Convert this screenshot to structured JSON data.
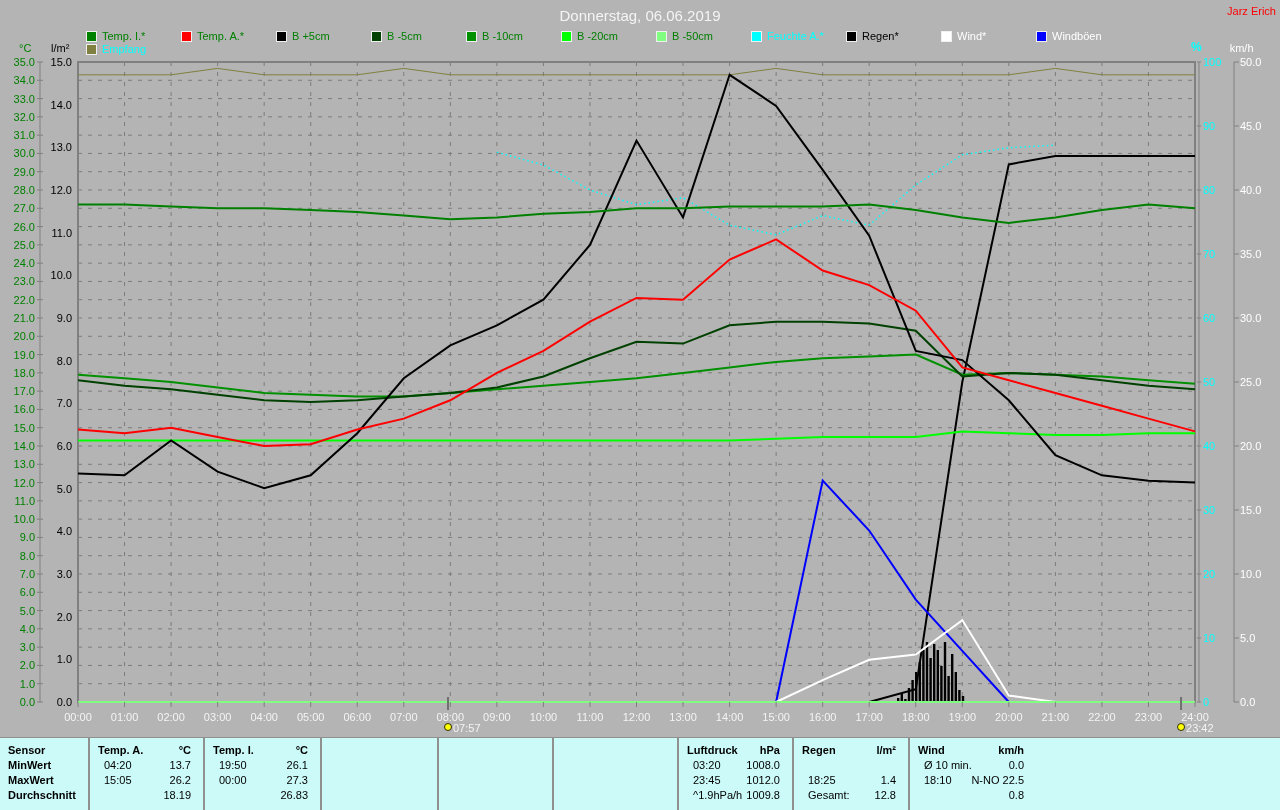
{
  "window": {
    "title": "Donnerstag, 06.06.2019",
    "author": "Jarz Erich"
  },
  "chart": {
    "axes": [
      {
        "kind": "y",
        "unit": "°C",
        "color": "#008000"
      },
      {
        "kind": "rain",
        "unit": "l/m²",
        "color": "#000000"
      },
      {
        "kind": "y2",
        "unit": "%",
        "color": "#00ffff"
      },
      {
        "kind": "y3",
        "unit": "km/h",
        "color": "#ffffff"
      }
    ],
    "chart_data": {
      "type": "line",
      "x": [
        "00:00",
        "01:00",
        "02:00",
        "03:00",
        "04:00",
        "05:00",
        "06:00",
        "07:00",
        "08:00",
        "09:00",
        "10:00",
        "11:00",
        "12:00",
        "13:00",
        "14:00",
        "15:00",
        "16:00",
        "17:00",
        "18:00",
        "19:00",
        "20:00",
        "21:00",
        "22:00",
        "23:00",
        "24:00"
      ],
      "yticks": [
        {
          "value": 35,
          "label": "35.0"
        },
        {
          "value": 34,
          "label": "34.0"
        },
        {
          "value": 33,
          "label": "33.0"
        },
        {
          "value": 32,
          "label": "32.0"
        },
        {
          "value": 31,
          "label": "31.0"
        },
        {
          "value": 30,
          "label": "30.0"
        },
        {
          "value": 29,
          "label": "29.0"
        },
        {
          "value": 28,
          "label": "28.0"
        },
        {
          "value": 27,
          "label": "27.0"
        },
        {
          "value": 26,
          "label": "26.0"
        },
        {
          "value": 25,
          "label": "25.0"
        },
        {
          "value": 24,
          "label": "24.0"
        },
        {
          "value": 23,
          "label": "23.0"
        },
        {
          "value": 22,
          "label": "22.0"
        },
        {
          "value": 21,
          "label": "21.0"
        },
        {
          "value": 20,
          "label": "20.0"
        },
        {
          "value": 19,
          "label": "19.0"
        },
        {
          "value": 18,
          "label": "18.0"
        },
        {
          "value": 17,
          "label": "17.0"
        },
        {
          "value": 16,
          "label": "16.0"
        },
        {
          "value": 15,
          "label": "15.0"
        },
        {
          "value": 14,
          "label": "14.0"
        },
        {
          "value": 13,
          "label": "13.0"
        },
        {
          "value": 12,
          "label": "12.0"
        },
        {
          "value": 11,
          "label": "11.0"
        },
        {
          "value": 10,
          "label": "10.0"
        },
        {
          "value": 9,
          "label": "9.0"
        },
        {
          "value": 8,
          "label": "8.0"
        },
        {
          "value": 7,
          "label": "7.0"
        },
        {
          "value": 6,
          "label": "6.0"
        },
        {
          "value": 5,
          "label": "5.0"
        },
        {
          "value": 4,
          "label": "4.0"
        },
        {
          "value": 3,
          "label": "3.0"
        },
        {
          "value": 2,
          "label": "2.0"
        },
        {
          "value": 1,
          "label": "1.0"
        },
        {
          "value": 0,
          "label": "0.0"
        }
      ],
      "ylim": [
        0,
        35
      ],
      "y2lim": [
        0,
        100
      ],
      "y3lim": [
        0,
        50
      ],
      "y2ticks": [
        100,
        90,
        80,
        70,
        60,
        50,
        40,
        30,
        20,
        10,
        0
      ],
      "y3ticks": [
        {
          "value": 50,
          "label": "50.0"
        },
        {
          "value": 45,
          "label": "45.0"
        },
        {
          "value": 40,
          "label": "40.0"
        },
        {
          "value": 35,
          "label": "35.0"
        },
        {
          "value": 30,
          "label": "30.0"
        },
        {
          "value": 25,
          "label": "25.0"
        },
        {
          "value": 20,
          "label": "20.0"
        },
        {
          "value": 15,
          "label": "15.0"
        },
        {
          "value": 10,
          "label": "10.0"
        },
        {
          "value": 5,
          "label": "5.0"
        },
        {
          "value": 0,
          "label": "0.0"
        }
      ],
      "series": [
        {
          "name": "Temp. I.*",
          "color": "#008000",
          "values": [
            27.2,
            27.2,
            27.1,
            27.0,
            27.0,
            26.9,
            26.8,
            26.6,
            26.4,
            26.5,
            26.7,
            26.8,
            27.0,
            27.0,
            27.1,
            27.1,
            27.1,
            27.2,
            26.9,
            26.5,
            26.2,
            26.5,
            26.9,
            27.2,
            27.0
          ]
        },
        {
          "name": "Temp. A.*",
          "color": "#ff0000",
          "values": [
            14.9,
            14.7,
            15.0,
            14.5,
            14.0,
            14.1,
            14.9,
            15.5,
            16.5,
            18.0,
            19.2,
            20.8,
            22.1,
            22.0,
            24.2,
            25.3,
            23.6,
            22.8,
            21.4,
            18.3,
            17.6,
            16.9,
            16.2,
            15.5,
            14.8
          ]
        },
        {
          "name": "B +5cm",
          "color": "#000000",
          "values": [
            12.5,
            12.4,
            14.3,
            12.6,
            11.7,
            12.4,
            14.7,
            17.7,
            19.5,
            20.6,
            22.0,
            25.0,
            30.7,
            26.5,
            34.3,
            32.6,
            29.1,
            25.5,
            19.2,
            18.7,
            16.5,
            13.5,
            12.4,
            12.1,
            12.0
          ]
        },
        {
          "name": "B -5cm",
          "color": "#004000",
          "values": [
            17.6,
            17.3,
            17.1,
            16.8,
            16.5,
            16.4,
            16.5,
            16.7,
            16.9,
            17.2,
            17.8,
            18.8,
            19.7,
            19.6,
            20.6,
            20.8,
            20.8,
            20.7,
            20.3,
            17.8,
            18.0,
            17.9,
            17.6,
            17.3,
            17.1
          ]
        },
        {
          "name": "B -10cm",
          "color": "#009000",
          "values": [
            17.9,
            17.7,
            17.5,
            17.2,
            16.9,
            16.8,
            16.7,
            16.7,
            16.9,
            17.1,
            17.3,
            17.5,
            17.7,
            18.0,
            18.3,
            18.6,
            18.8,
            18.9,
            19.0,
            17.9,
            18.0,
            17.9,
            17.8,
            17.6,
            17.4
          ]
        },
        {
          "name": "B -20cm",
          "color": "#00ff00",
          "values": [
            14.3,
            14.3,
            14.3,
            14.3,
            14.3,
            14.3,
            14.3,
            14.3,
            14.3,
            14.3,
            14.3,
            14.3,
            14.3,
            14.3,
            14.3,
            14.4,
            14.5,
            14.5,
            14.5,
            14.8,
            14.7,
            14.6,
            14.6,
            14.7,
            14.7
          ]
        },
        {
          "name": "B -50cm",
          "color": "#80ff80",
          "values": [
            0,
            0,
            0,
            0,
            0,
            0,
            0,
            0,
            0,
            0,
            0,
            0,
            0,
            0,
            0,
            0,
            0,
            0,
            0,
            0,
            0,
            0,
            0,
            0,
            0
          ]
        },
        {
          "name": "Feuchte A.*",
          "color": "#00ffff",
          "axis": "y2",
          "line_style": "dotted",
          "values": [
            null,
            null,
            null,
            null,
            null,
            null,
            null,
            null,
            null,
            85.9,
            83.9,
            80.0,
            77.7,
            78.8,
            74.5,
            73.0,
            76.0,
            74.5,
            80.8,
            85.5,
            86.6,
            87.0,
            null,
            null,
            null
          ]
        },
        {
          "name": "Wind*",
          "color": "#ffffff",
          "axis": "y3",
          "values": [
            null,
            null,
            null,
            null,
            null,
            null,
            null,
            null,
            null,
            null,
            null,
            null,
            null,
            null,
            null,
            0,
            1.7,
            3.3,
            3.7,
            6.4,
            0.5,
            0,
            null,
            null,
            null
          ]
        },
        {
          "name": "Windböen",
          "color": "#0000ff",
          "axis": "y3",
          "values": [
            null,
            null,
            null,
            null,
            null,
            null,
            null,
            null,
            null,
            null,
            null,
            null,
            null,
            null,
            null,
            0,
            17.3,
            13.4,
            8.0,
            4.0,
            0,
            null,
            null,
            null,
            null
          ]
        },
        {
          "name": "Empfang",
          "color": "#808040",
          "axis": "y2",
          "values": [
            98,
            98,
            98,
            99,
            98,
            98,
            98,
            99,
            98,
            98,
            98,
            98,
            98,
            98,
            98,
            99,
            98,
            98,
            98,
            98,
            98,
            99,
            98,
            98,
            98
          ]
        }
      ]
    },
    "rain": {
      "chart_data": {
        "type": "line",
        "ylim": [
          0,
          15
        ],
        "x": [
          null,
          null,
          null,
          null,
          null,
          null,
          null,
          null,
          null,
          null,
          null,
          null,
          null,
          null,
          null,
          null,
          null,
          null,
          null,
          null,
          null,
          null,
          null,
          null,
          null
        ],
        "yticks": [
          {
            "value": 15,
            "label": "15.0"
          },
          {
            "value": 14,
            "label": "14.0"
          },
          {
            "value": 13,
            "label": "13.0"
          },
          {
            "value": 12,
            "label": "12.0"
          },
          {
            "value": 11,
            "label": "11.0"
          },
          {
            "value": 10,
            "label": "10.0"
          },
          {
            "value": 9,
            "label": "9.0"
          },
          {
            "value": 8,
            "label": "8.0"
          },
          {
            "value": 7,
            "label": "7.0"
          },
          {
            "value": 6,
            "label": "6.0"
          },
          {
            "value": 5,
            "label": "5.0"
          },
          {
            "value": 4,
            "label": "4.0"
          },
          {
            "value": 3,
            "label": "3.0"
          },
          {
            "value": 2,
            "label": "2.0"
          },
          {
            "value": 1,
            "label": "1.0"
          },
          {
            "value": 0,
            "label": "0.0"
          }
        ],
        "series": [
          {
            "name": "Regen*",
            "color": "#000000",
            "values": [
              null,
              null,
              null,
              null,
              null,
              null,
              null,
              null,
              null,
              null,
              null,
              null,
              null,
              null,
              null,
              null,
              null,
              0,
              0.3,
              7.5,
              12.6,
              12.8,
              12.8,
              12.8,
              12.8
            ]
          }
        ]
      }
    },
    "sun_markers": [
      "07:57",
      "23:42"
    ]
  },
  "statistics": {
    "row_labels": [
      "Sensor",
      "MinWert",
      "MaxWert",
      "Durchschnitt"
    ],
    "blocks": [
      {
        "name": "Temp. A.",
        "unit": "°C",
        "rows": [
          {
            "time": "04:20",
            "value": "13.7"
          },
          {
            "time": "15:05",
            "value": "26.2"
          },
          {
            "value": "18.19"
          }
        ]
      },
      {
        "name": "Temp. I.",
        "unit": "°C",
        "rows": [
          {
            "time": "19:50",
            "value": "26.1"
          },
          {
            "time": "00:00",
            "value": "27.3"
          },
          {
            "value": "26.83"
          }
        ]
      },
      {
        "name": "Luftdruck",
        "unit": "hPa",
        "rows": [
          {
            "time": "03:20",
            "value": "1008.0"
          },
          {
            "time": "23:45",
            "value": "1012.0"
          },
          {
            "time": "^1.9hPa/h",
            "value": "1009.8"
          }
        ]
      },
      {
        "name": "Regen",
        "unit": "l/m²",
        "rows": [
          {},
          {
            "time": "18:25",
            "value": "1.4"
          },
          {
            "time": "Gesamt:",
            "value": "12.8"
          }
        ]
      },
      {
        "name": "Wind",
        "unit": "km/h",
        "rows": [
          {
            "time": "Ø 10 min.",
            "value": "0.0"
          },
          {
            "time": "18:10",
            "value": "N-NO 22.5"
          },
          {
            "value": "0.8"
          }
        ]
      }
    ]
  }
}
